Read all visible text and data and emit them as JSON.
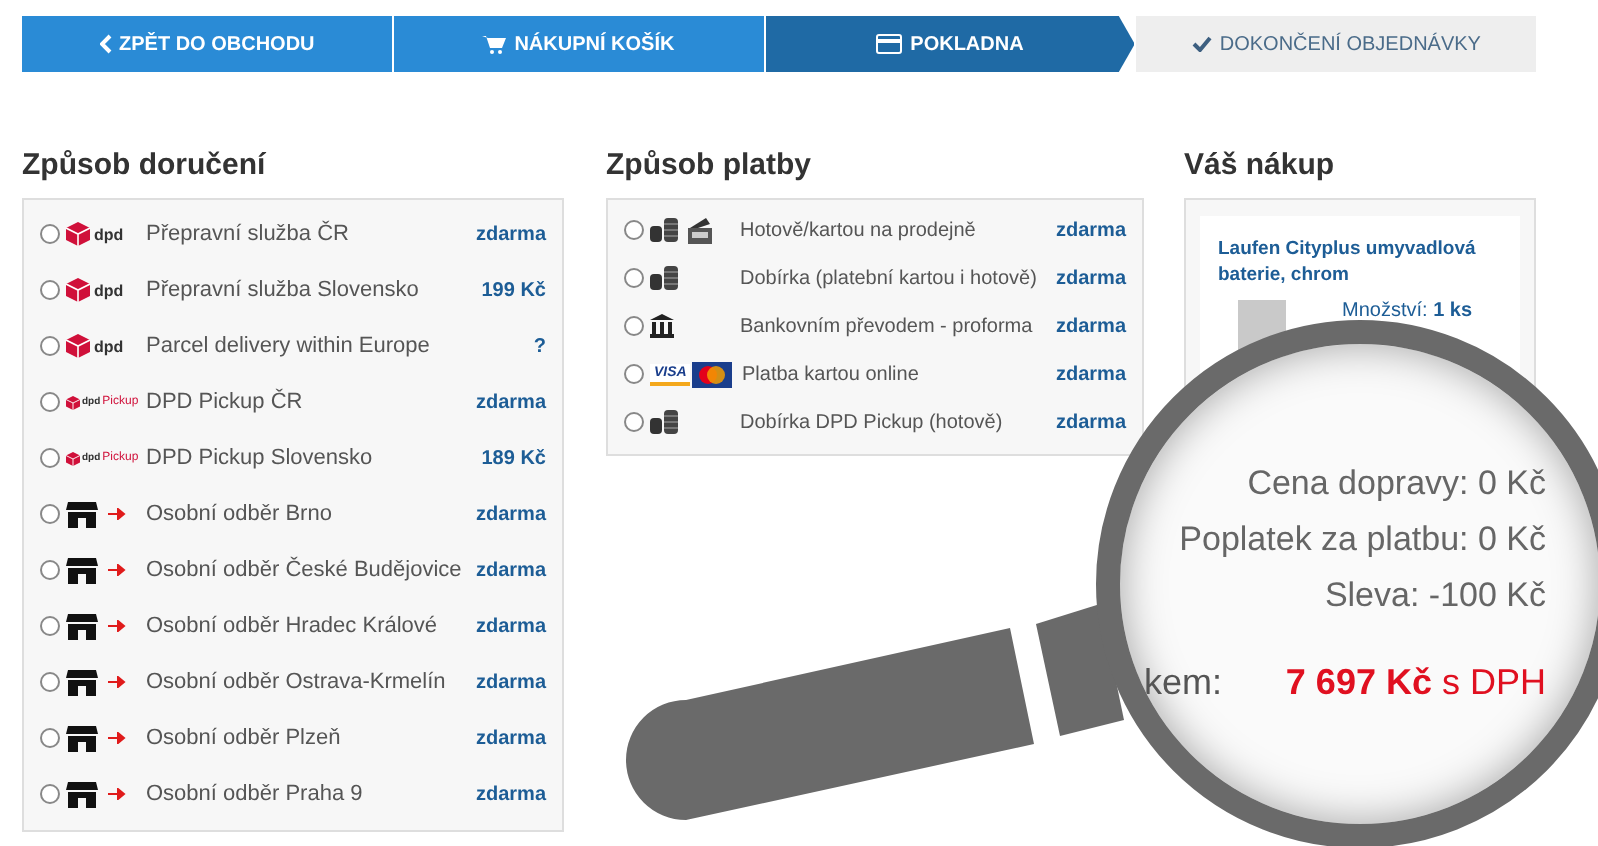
{
  "steps": [
    {
      "label": "ZPĚT DO OBCHODU",
      "kind": "back",
      "selected": false
    },
    {
      "label": "NÁKUPNÍ KOŠÍK",
      "kind": "cart",
      "selected": false
    },
    {
      "label": "POKLADNA",
      "kind": "checkout",
      "selected": true
    },
    {
      "label": "DOKONČENÍ OBJEDNÁVKY",
      "kind": "finish",
      "selected": false
    }
  ],
  "delivery": {
    "title": "Způsob doručení",
    "options": [
      {
        "logo": "dpd",
        "kind": "dpd",
        "label": "Přepravní služba ČR",
        "price": "zdarma",
        "selected": false
      },
      {
        "logo": "dpd",
        "kind": "dpd",
        "label": "Přepravní služba Slovensko",
        "price": "199 Kč",
        "selected": false
      },
      {
        "logo": "dpd",
        "kind": "dpd",
        "label": "Parcel delivery within Europe",
        "price": "?",
        "selected": false
      },
      {
        "logo": "dpd",
        "logo_extra": "Pickup",
        "kind": "pickup",
        "label": "DPD Pickup ČR",
        "price": "zdarma",
        "selected": false
      },
      {
        "logo": "dpd",
        "logo_extra": "Pickup",
        "kind": "pickup",
        "label": "DPD Pickup Slovensko",
        "price": "189 Kč",
        "selected": false
      },
      {
        "kind": "store",
        "label": "Osobní odběr Brno",
        "price": "zdarma",
        "selected": false
      },
      {
        "kind": "store",
        "label": "Osobní odběr České Budějovice",
        "price": "zdarma",
        "selected": false
      },
      {
        "kind": "store",
        "label": "Osobní odběr Hradec Králové",
        "price": "zdarma",
        "selected": false
      },
      {
        "kind": "store",
        "label": "Osobní odběr Ostrava-Krmelín",
        "price": "zdarma",
        "selected": false
      },
      {
        "kind": "store",
        "label": "Osobní odběr Plzeň",
        "price": "zdarma",
        "selected": false
      },
      {
        "kind": "store",
        "label": "Osobní odběr Praha 9",
        "price": "zdarma",
        "selected": false
      }
    ]
  },
  "payment": {
    "title": "Způsob platby",
    "options": [
      {
        "kind": "cash_card",
        "label": "Hotově/kartou na prodejně",
        "price": "zdarma",
        "selected": false
      },
      {
        "kind": "cash",
        "label": "Dobírka (platební kartou i hotově)",
        "price": "zdarma",
        "selected": false
      },
      {
        "kind": "bank",
        "label": "Bankovním převodem - proforma",
        "price": "zdarma",
        "selected": false
      },
      {
        "kind": "cards",
        "logo": "VISA",
        "label": "Platba kartou online",
        "price": "zdarma",
        "selected": false
      },
      {
        "kind": "cash",
        "label": "Dobírka DPD Pickup (hotově)",
        "price": "zdarma",
        "selected": false
      }
    ]
  },
  "summary": {
    "title": "Váš nákup",
    "product": {
      "name": "Laufen Cityplus umyvadlová baterie, chrom",
      "quantity": "Množství: **1 ks**"
    }
  },
  "magnifier": {
    "lines": [
      "Cena dopravy: 0 Kč",
      "Poplatek za platbu: 0 Kč",
      "Sleva: -100 Kč"
    ],
    "total_label": "kem:",
    "total": "**7 697 Kč** s DPH"
  }
}
